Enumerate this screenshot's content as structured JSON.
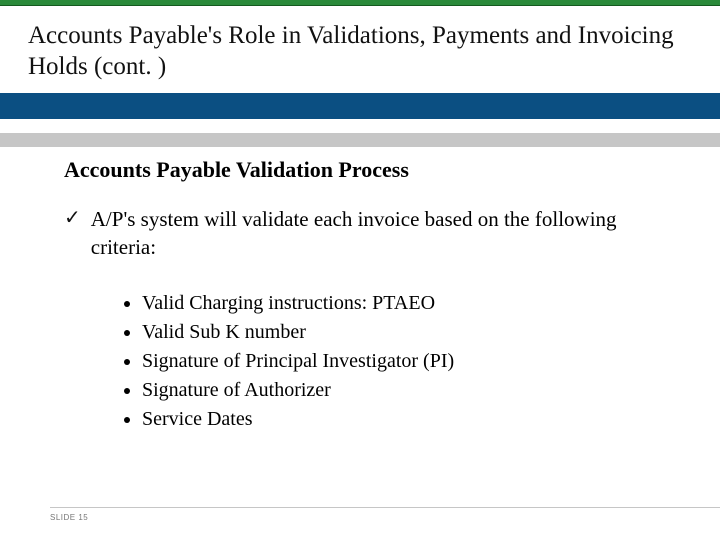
{
  "title": "Accounts Payable's Role in Validations, Payments and Invoicing Holds (cont. )",
  "section_heading": "Accounts Payable Validation Process",
  "check_item": "A/P's system will validate each invoice based on the following criteria:",
  "bullets": [
    "Valid Charging instructions: PTAEO",
    "Valid Sub K number",
    "Signature of Principal Investigator (PI)",
    "Signature of Authorizer",
    "Service Dates"
  ],
  "footer": "SLIDE 15"
}
